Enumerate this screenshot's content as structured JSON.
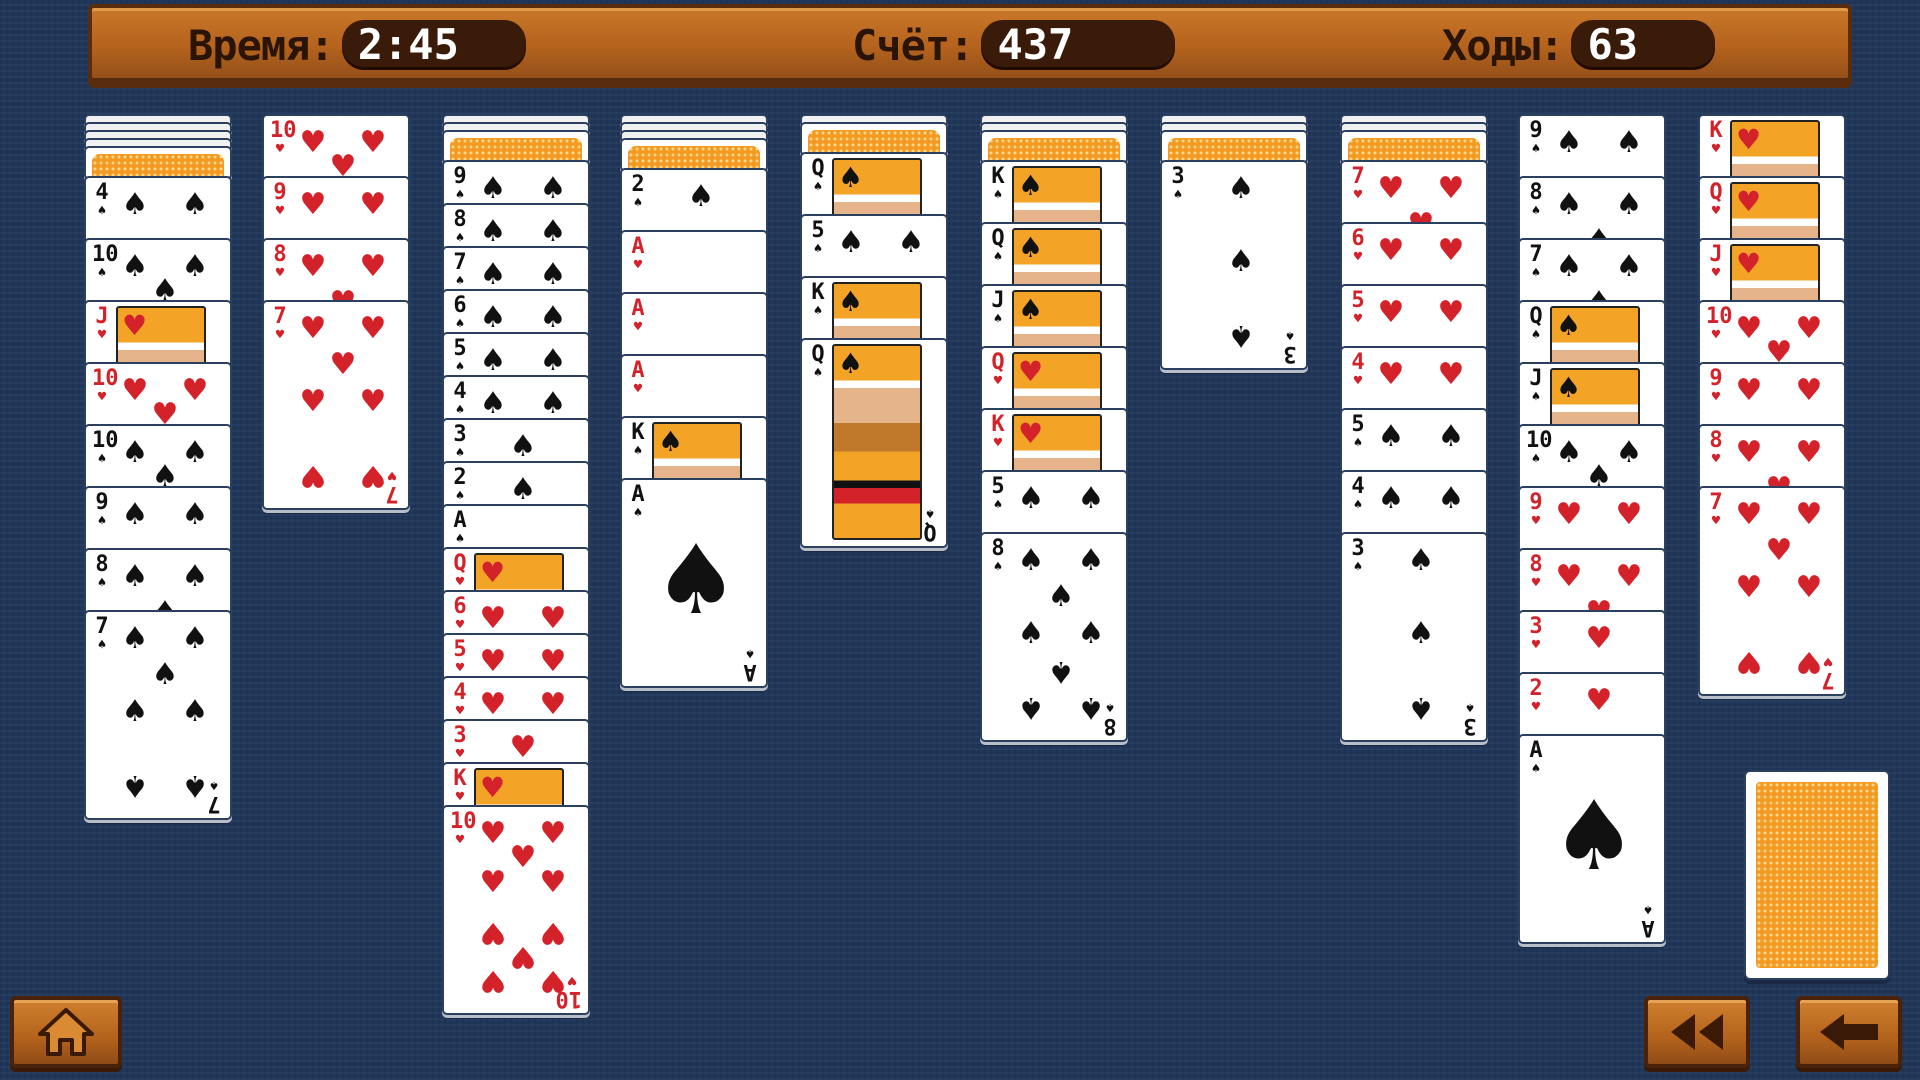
{
  "header": {
    "time_label": "Время:",
    "time_value": "2:45",
    "score_label": "Счёт:",
    "score_value": "437",
    "moves_label": "Ходы:",
    "moves_value": "63"
  },
  "colors": {
    "felt": "#20375a",
    "wood": "#b5631d",
    "card_back": "#f39a23",
    "red_suit": "#d3222a"
  },
  "tableau": [
    {
      "hidden": 4,
      "cards": [
        {
          "rank": "4",
          "suit": "♠"
        },
        {
          "rank": "10",
          "suit": "♠"
        },
        {
          "rank": "J",
          "suit": "♥"
        },
        {
          "rank": "10",
          "suit": "♥"
        },
        {
          "rank": "10",
          "suit": "♠"
        },
        {
          "rank": "9",
          "suit": "♠"
        },
        {
          "rank": "8",
          "suit": "♠"
        },
        {
          "rank": "7",
          "suit": "♠"
        }
      ]
    },
    {
      "hidden": 0,
      "cards": [
        {
          "rank": "10",
          "suit": "♥"
        },
        {
          "rank": "9",
          "suit": "♥"
        },
        {
          "rank": "8",
          "suit": "♥"
        },
        {
          "rank": "7",
          "suit": "♥"
        }
      ]
    },
    {
      "hidden": 2,
      "cards": [
        {
          "rank": "9",
          "suit": "♠"
        },
        {
          "rank": "8",
          "suit": "♠"
        },
        {
          "rank": "7",
          "suit": "♠"
        },
        {
          "rank": "6",
          "suit": "♠"
        },
        {
          "rank": "5",
          "suit": "♠"
        },
        {
          "rank": "4",
          "suit": "♠"
        },
        {
          "rank": "3",
          "suit": "♠"
        },
        {
          "rank": "2",
          "suit": "♠"
        },
        {
          "rank": "A",
          "suit": "♠"
        },
        {
          "rank": "Q",
          "suit": "♥"
        },
        {
          "rank": "6",
          "suit": "♥"
        },
        {
          "rank": "5",
          "suit": "♥"
        },
        {
          "rank": "4",
          "suit": "♥"
        },
        {
          "rank": "3",
          "suit": "♥"
        },
        {
          "rank": "K",
          "suit": "♥"
        },
        {
          "rank": "10",
          "suit": "♥"
        }
      ]
    },
    {
      "hidden": 3,
      "cards": [
        {
          "rank": "2",
          "suit": "♠"
        },
        {
          "rank": "A",
          "suit": "♥"
        },
        {
          "rank": "A",
          "suit": "♥"
        },
        {
          "rank": "A",
          "suit": "♥"
        },
        {
          "rank": "K",
          "suit": "♠"
        },
        {
          "rank": "A",
          "suit": "♠"
        }
      ]
    },
    {
      "hidden": 1,
      "cards": [
        {
          "rank": "Q",
          "suit": "♠"
        },
        {
          "rank": "5",
          "suit": "♠"
        },
        {
          "rank": "K",
          "suit": "♠"
        },
        {
          "rank": "Q",
          "suit": "♠"
        }
      ]
    },
    {
      "hidden": 2,
      "cards": [
        {
          "rank": "K",
          "suit": "♠"
        },
        {
          "rank": "Q",
          "suit": "♠"
        },
        {
          "rank": "J",
          "suit": "♠"
        },
        {
          "rank": "Q",
          "suit": "♥"
        },
        {
          "rank": "K",
          "suit": "♥"
        },
        {
          "rank": "5",
          "suit": "♠"
        },
        {
          "rank": "8",
          "suit": "♠"
        }
      ]
    },
    {
      "hidden": 2,
      "cards": [
        {
          "rank": "3",
          "suit": "♠"
        }
      ]
    },
    {
      "hidden": 2,
      "cards": [
        {
          "rank": "7",
          "suit": "♥"
        },
        {
          "rank": "6",
          "suit": "♥"
        },
        {
          "rank": "5",
          "suit": "♥"
        },
        {
          "rank": "4",
          "suit": "♥"
        },
        {
          "rank": "5",
          "suit": "♠"
        },
        {
          "rank": "4",
          "suit": "♠"
        },
        {
          "rank": "3",
          "suit": "♠"
        }
      ]
    },
    {
      "hidden": 0,
      "cards": [
        {
          "rank": "9",
          "suit": "♠"
        },
        {
          "rank": "8",
          "suit": "♠"
        },
        {
          "rank": "7",
          "suit": "♠"
        },
        {
          "rank": "Q",
          "suit": "♠"
        },
        {
          "rank": "J",
          "suit": "♠"
        },
        {
          "rank": "10",
          "suit": "♠"
        },
        {
          "rank": "9",
          "suit": "♥"
        },
        {
          "rank": "8",
          "suit": "♥"
        },
        {
          "rank": "3",
          "suit": "♥"
        },
        {
          "rank": "2",
          "suit": "♥"
        },
        {
          "rank": "A",
          "suit": "♠"
        }
      ]
    },
    {
      "hidden": 0,
      "cards": [
        {
          "rank": "K",
          "suit": "♥"
        },
        {
          "rank": "Q",
          "suit": "♥"
        },
        {
          "rank": "J",
          "suit": "♥"
        },
        {
          "rank": "10",
          "suit": "♥"
        },
        {
          "rank": "9",
          "suit": "♥"
        },
        {
          "rank": "8",
          "suit": "♥"
        },
        {
          "rank": "7",
          "suit": "♥"
        }
      ]
    }
  ],
  "buttons": {
    "home_icon": "home-icon",
    "undo_all_icon": "rewind-icon",
    "undo_icon": "back-arrow-icon"
  }
}
